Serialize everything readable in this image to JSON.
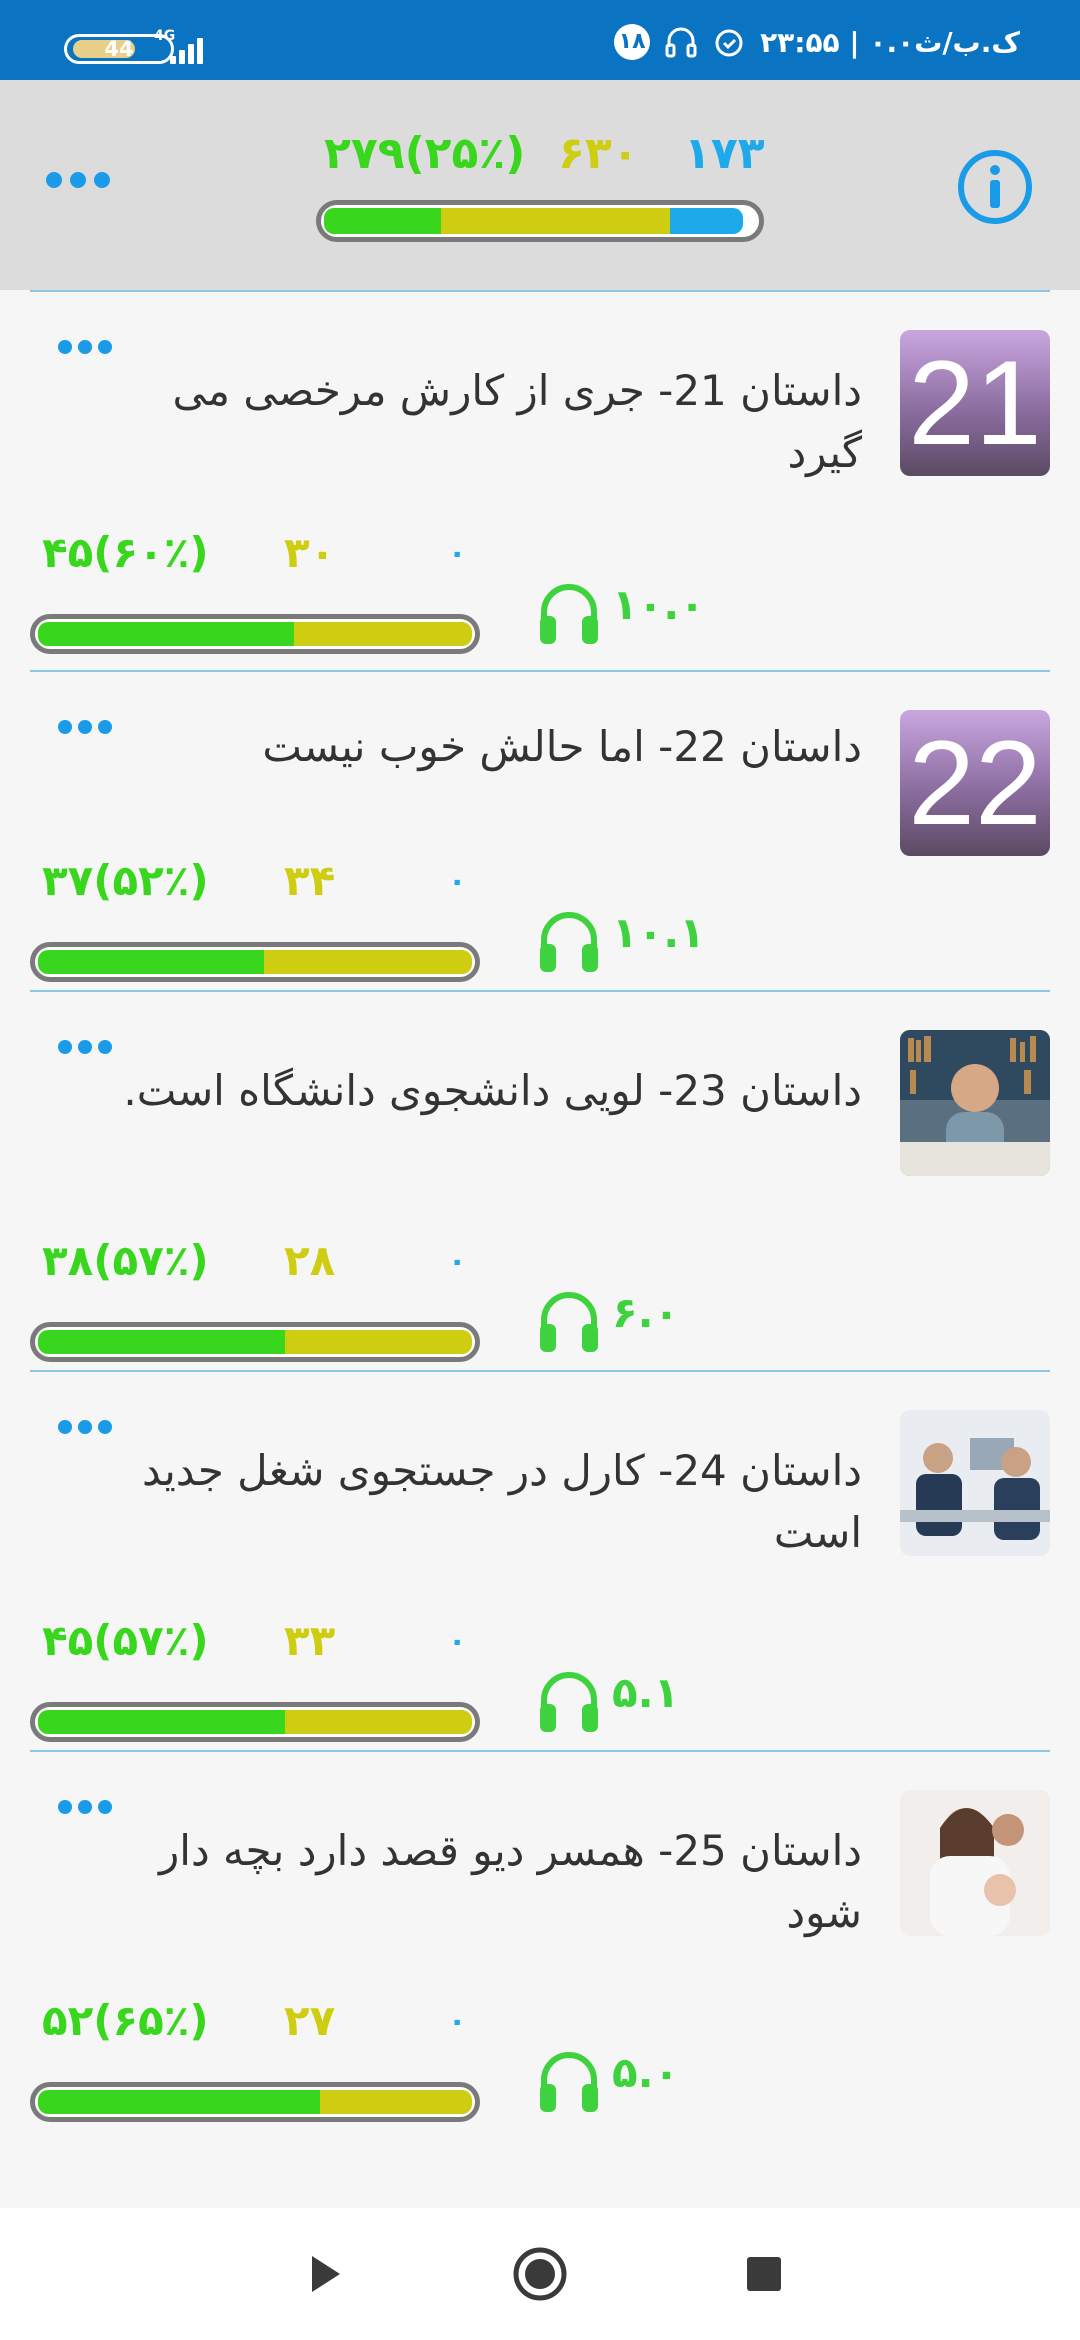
{
  "status_bar": {
    "time": "۲۳:۵۵ | ۰.۰ک.ب/ث",
    "notification_count": "۱۸",
    "battery": "44",
    "network": "4G"
  },
  "header": {
    "stats": {
      "blue": "۱۷۳",
      "yellow": "۶۳۰",
      "green": "۲۷۹(۲۵٪)"
    },
    "progress": {
      "green": 0.27,
      "yellow": 0.53,
      "blue": 0.17
    },
    "info_icon": "info-icon",
    "more_icon": "more-icon"
  },
  "colors": {
    "blue": "#1ea9ea",
    "yellow": "#cfcd12",
    "green": "#38d61c"
  },
  "stories": [
    {
      "thumb_text": "21",
      "title": "داستان 21- جری از کارش مرخصی می گیرد",
      "stat_blue": "۰",
      "stat_yellow": "۳۰",
      "stat_green": "۴۵(۶۰٪)",
      "duration": "۱۰.۰",
      "progress": {
        "green": 0.59,
        "yellow": 0.41
      }
    },
    {
      "thumb_text": "22",
      "title": "داستان 22- اما حالش خوب نیست",
      "stat_blue": "۰",
      "stat_yellow": "۳۴",
      "stat_green": "۳۷(۵۲٪)",
      "duration": "۱۰.۱",
      "progress": {
        "green": 0.52,
        "yellow": 0.48
      }
    },
    {
      "thumb_text": "",
      "title": "داستان 23- لویی  دانشجوی دانشگاه است.",
      "stat_blue": "۰",
      "stat_yellow": "۲۸",
      "stat_green": "۳۸(۵۷٪)",
      "duration": "۶.۰",
      "progress": {
        "green": 0.57,
        "yellow": 0.43
      }
    },
    {
      "thumb_text": "",
      "title": "داستان 24- کارل در جستجوی شغل جدید است",
      "stat_blue": "۰",
      "stat_yellow": "۳۳",
      "stat_green": "۴۵(۵۷٪)",
      "duration": "۵.۱",
      "progress": {
        "green": 0.57,
        "yellow": 0.43
      }
    },
    {
      "thumb_text": "",
      "title": "داستان 25- همسر دیو قصد دارد بچه دار شود",
      "stat_blue": "۰",
      "stat_yellow": "۲۷",
      "stat_green": "۵۲(۶۵٪)",
      "duration": "۵.۰",
      "progress": {
        "green": 0.65,
        "yellow": 0.35
      }
    }
  ]
}
